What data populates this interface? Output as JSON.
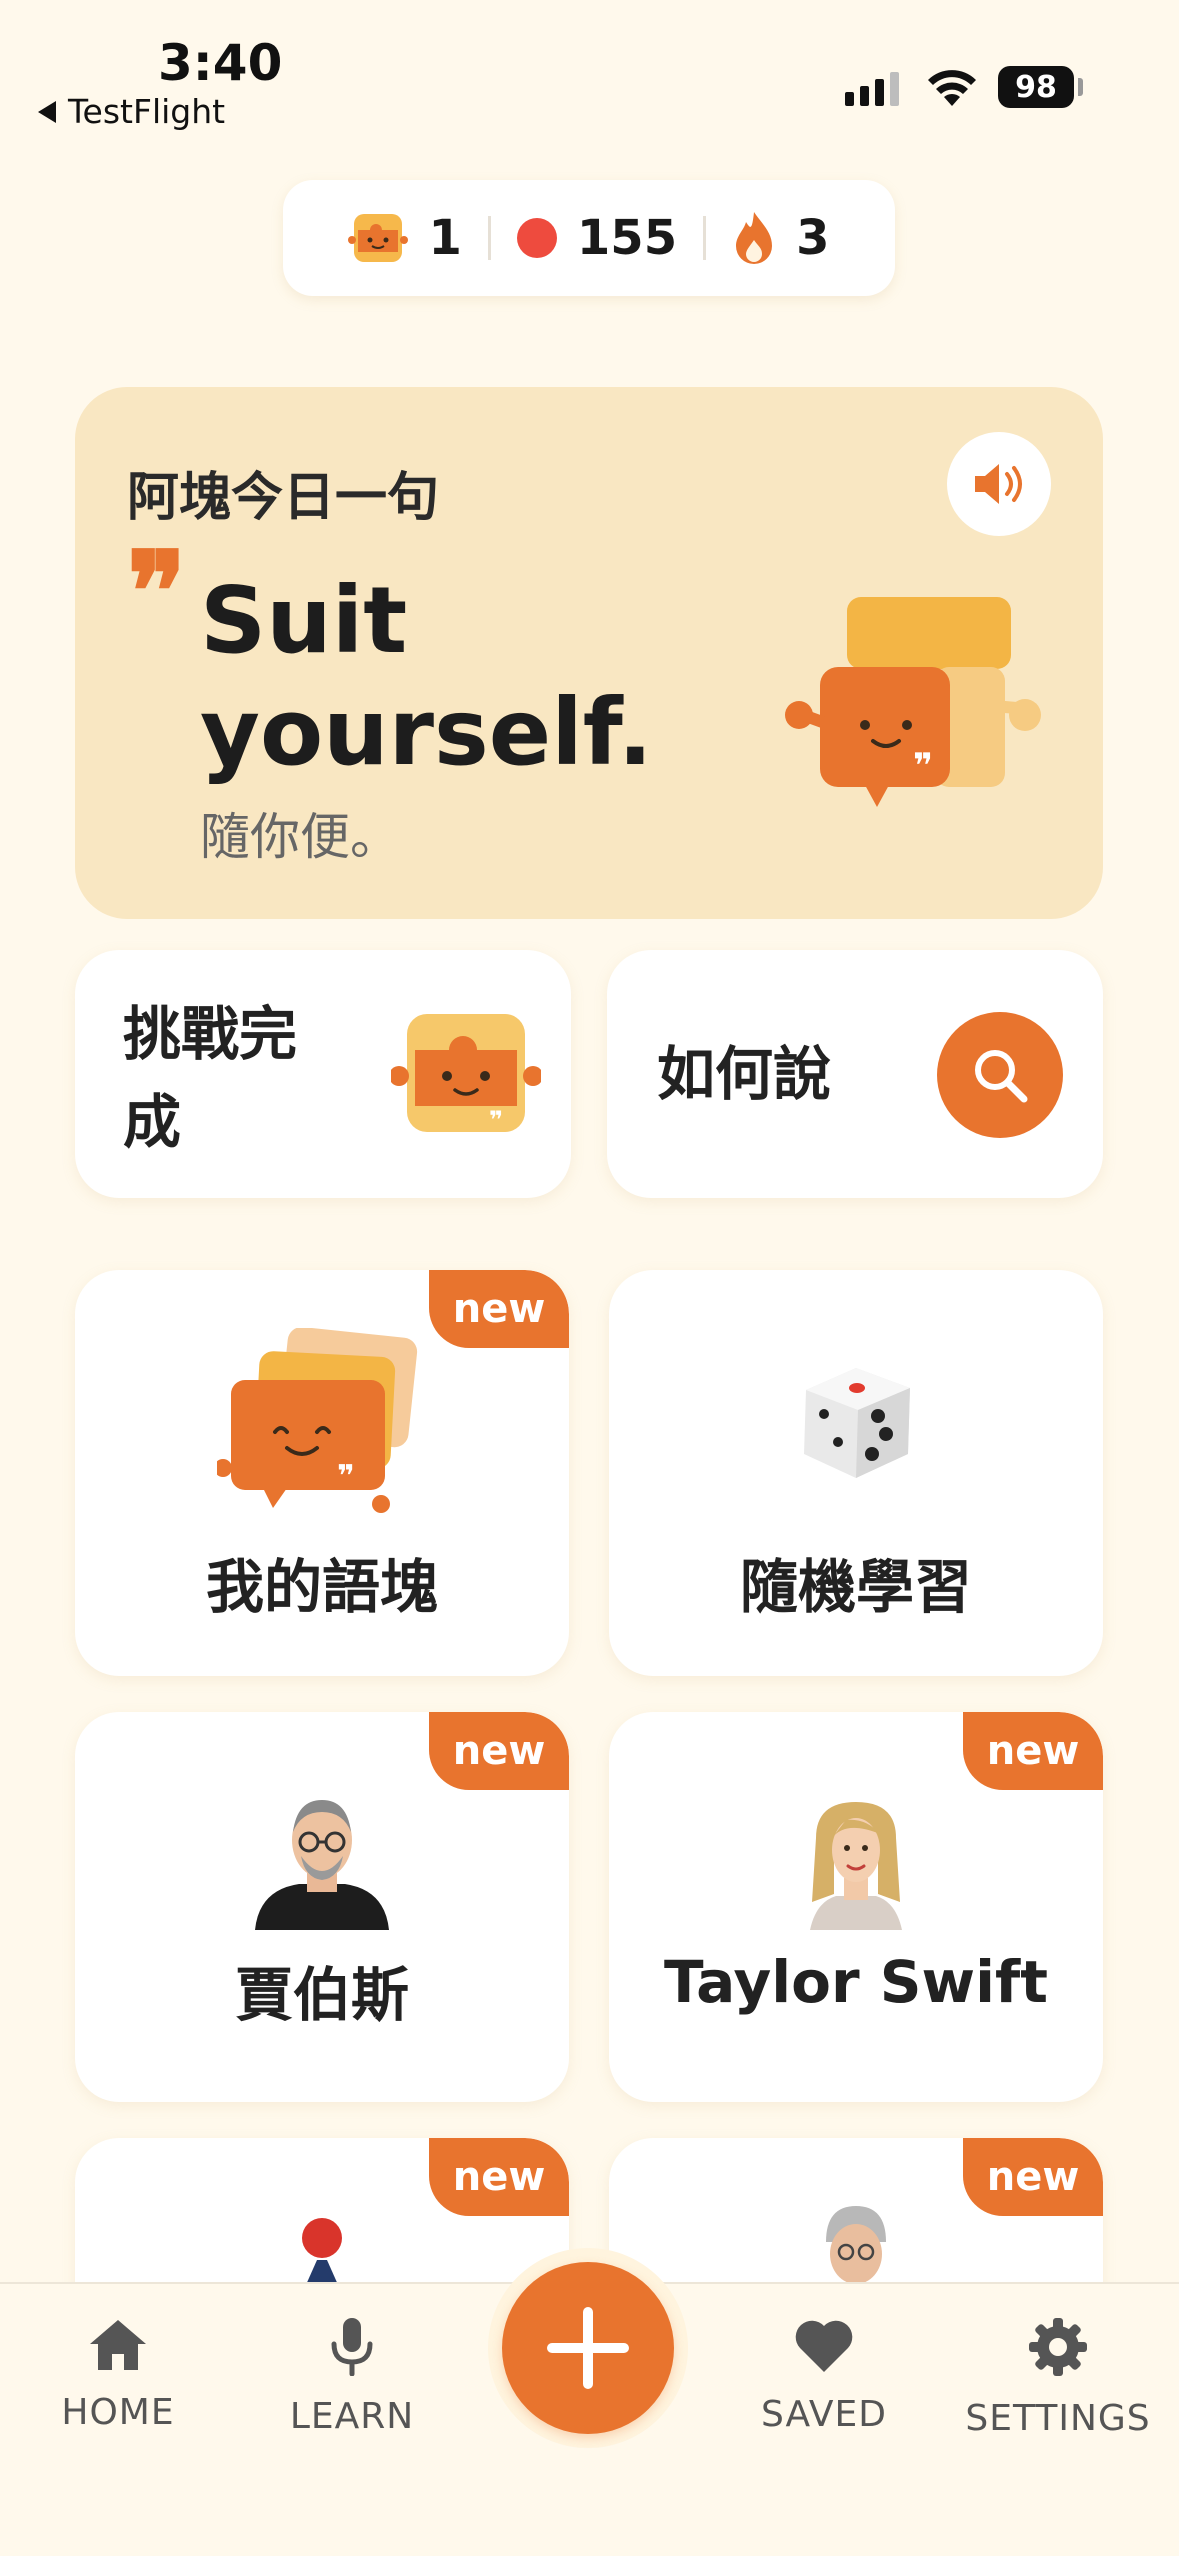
{
  "status_bar": {
    "time": "3:40",
    "back_app": "TestFlight",
    "battery": "98"
  },
  "stats": {
    "chunks": "1",
    "points": "155",
    "streak": "3"
  },
  "daily": {
    "title": "阿塊今日一句",
    "quote_mark": "❞",
    "phrase_en": "Suit yourself.",
    "phrase_zh": "隨你便。"
  },
  "actions": {
    "challenge_label": "挑戰完成",
    "challenge_line1": "挑戰完",
    "challenge_line2": "成",
    "how_to_say_label": "如何說"
  },
  "cards": [
    {
      "label": "我的語塊",
      "badge": "new"
    },
    {
      "label": "隨機學習"
    },
    {
      "label": "賈伯斯",
      "badge": "new"
    },
    {
      "label": "Taylor Swift",
      "badge": "new"
    },
    {
      "label": "",
      "badge": "new"
    },
    {
      "label": "",
      "badge": "new"
    }
  ],
  "nav": {
    "home": "HOME",
    "learn": "LEARN",
    "saved": "SAVED",
    "settings": "SETTINGS"
  },
  "colors": {
    "accent": "#E8742E",
    "background": "#FFF9EC",
    "daily_card": "#F9E7C2",
    "points_dot": "#EE4B3E"
  }
}
